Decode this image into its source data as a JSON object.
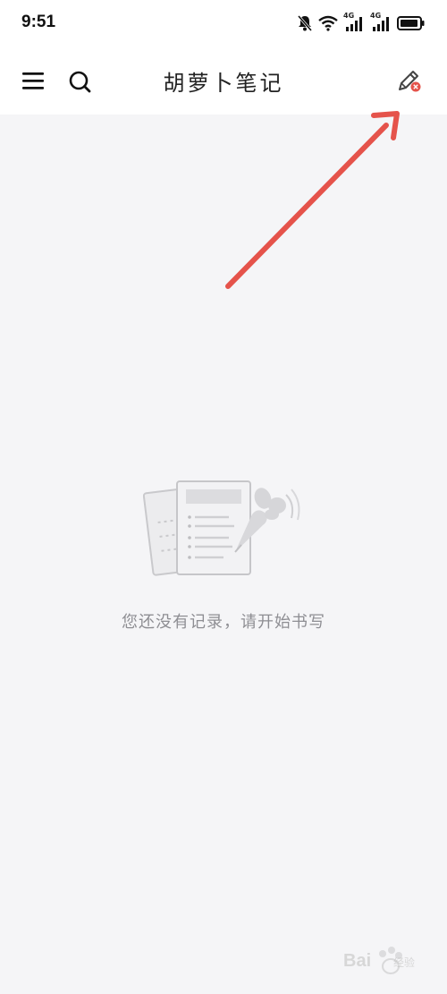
{
  "status_bar": {
    "time": "9:51",
    "icons": [
      "bell-muted-icon",
      "wifi-icon",
      "signal-4g-icon",
      "signal-4g-icon",
      "battery-icon"
    ],
    "signal_label_1": "4G",
    "signal_label_2": "4G"
  },
  "app_bar": {
    "title": "胡萝卜笔记",
    "menu_icon": "hamburger-menu-icon",
    "search_icon": "search-icon",
    "edit_icon": "pencil-edit-icon"
  },
  "empty_state": {
    "illustration": "notes-carrot-illustration",
    "message": "您还没有记录，请开始书写"
  },
  "annotation": {
    "arrow_color": "#e5534b"
  },
  "watermark": {
    "logo_text": "Bai",
    "sub_text": "经验"
  },
  "colors": {
    "background": "#f5f5f7",
    "app_bar": "#ffffff",
    "muted_text": "#8e8e93",
    "badge": "#e5534b"
  }
}
